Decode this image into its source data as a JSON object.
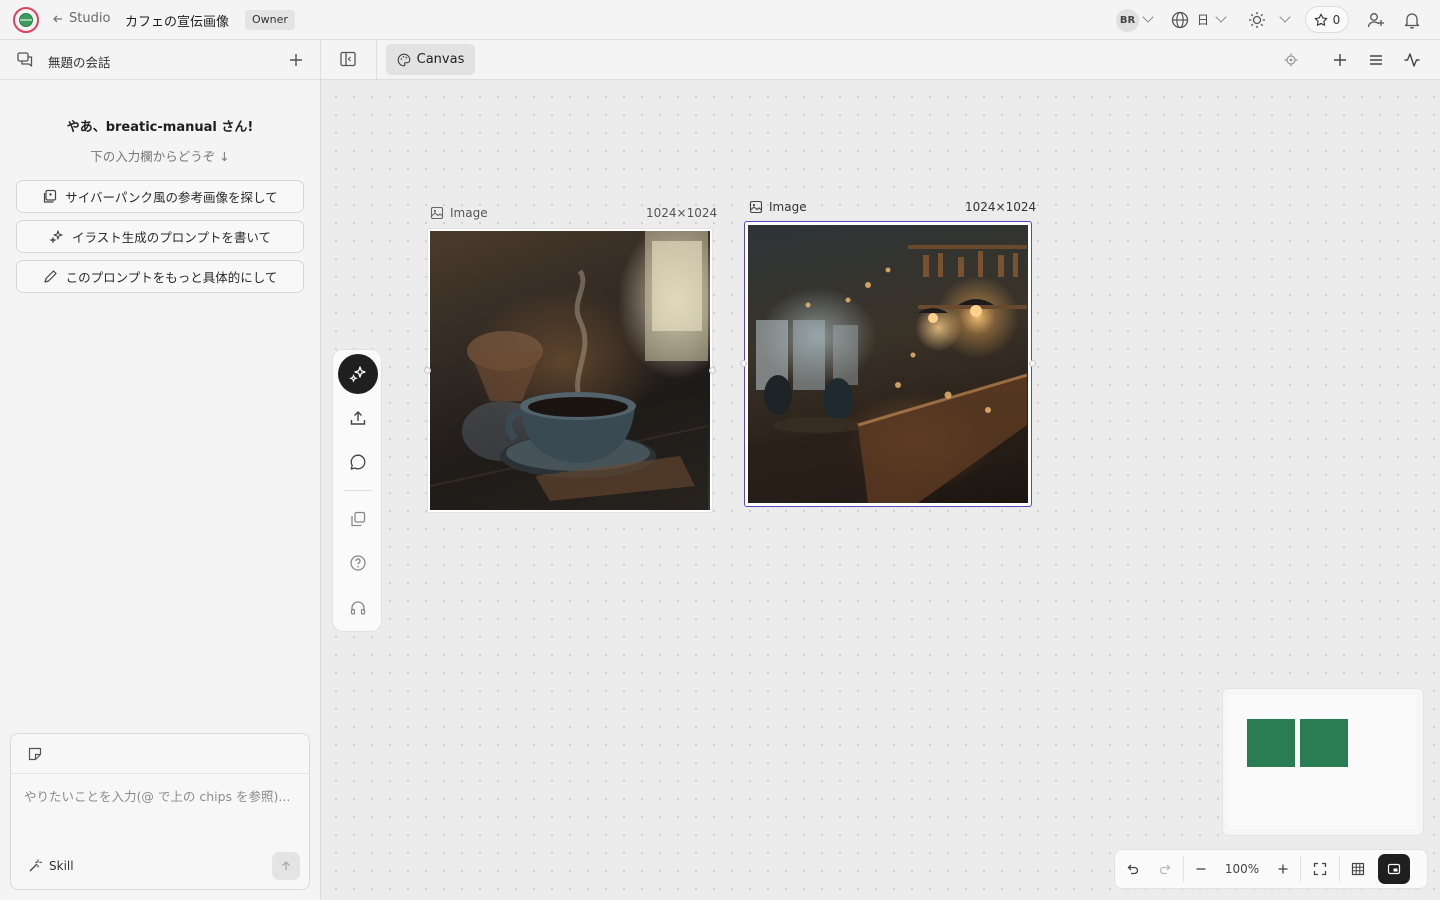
{
  "topbar": {
    "back_label": "Studio",
    "project_title": "カフェの宣伝画像",
    "role_badge": "Owner",
    "user_initials": "BR",
    "language": "日",
    "star_count": "0"
  },
  "sidebar": {
    "title": "無題の会話",
    "greeting": "やあ、breatic-manual さん!",
    "greeting_sub": "下の入力欄からどうぞ ↓",
    "chips": [
      {
        "label": "サイバーパンク風の参考画像を探して",
        "icon": "image-search-icon"
      },
      {
        "label": "イラスト生成のプロンプトを書いて",
        "icon": "sparkles-icon"
      },
      {
        "label": "このプロンプトをもっと具体的にして",
        "icon": "pencil-icon"
      }
    ],
    "composer": {
      "placeholder": "やりたいことを入力(@ で上の chips を参照)...",
      "skill_label": "Skill"
    }
  },
  "canvas_header": {
    "tab_label": "Canvas"
  },
  "canvas": {
    "nodes": [
      {
        "type_label": "Image",
        "dimensions": "1024×1024",
        "subject": "coffee cup by window",
        "selected": false
      },
      {
        "type_label": "Image",
        "dimensions": "1024×1024",
        "subject": "cafe interior",
        "selected": true
      }
    ],
    "minimap_color": "#2a7d52",
    "selection_color": "#5846c9"
  },
  "zoombar": {
    "zoom_level": "100%"
  }
}
